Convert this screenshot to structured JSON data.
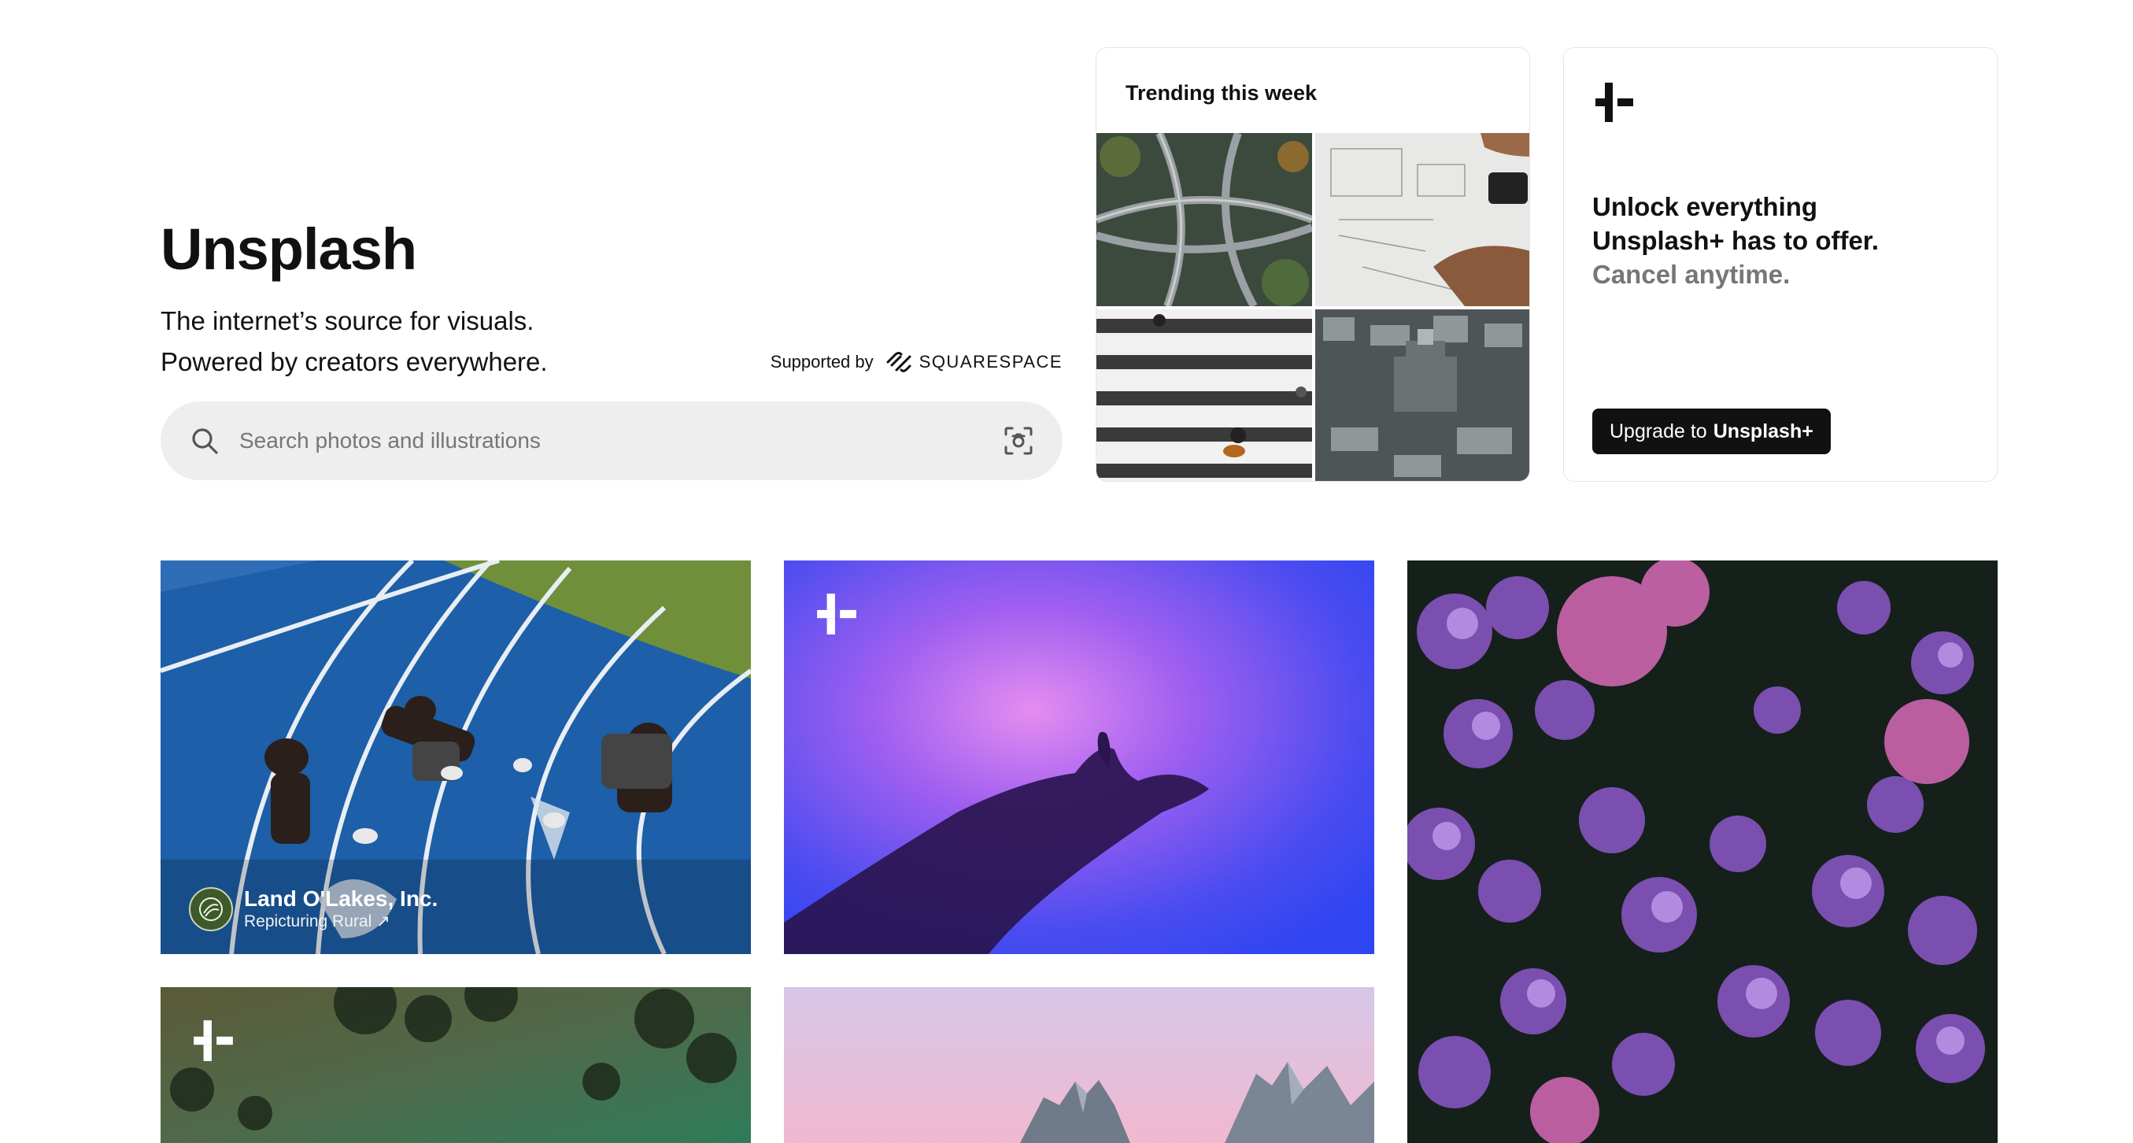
{
  "hero": {
    "title": "Unsplash",
    "tagline_line1": "The internet’s source for visuals.",
    "tagline_line2": "Powered by creators everywhere.",
    "supported_by": "Supported by",
    "sponsor_logo_text": "SQUARESPACE"
  },
  "search": {
    "placeholder": "Search photos and illustrations",
    "value": "",
    "icon": "search-icon",
    "visual_search_icon": "visual-search-icon"
  },
  "trending": {
    "title": "Trending this week",
    "images": [
      "highway-interchange-aerial",
      "architect-drawing-plans",
      "pedestrian-crosswalk-aerial",
      "miniature-temple-city"
    ]
  },
  "plus_card": {
    "icon": "unsplash-plus-icon",
    "headline_line1": "Unlock everything",
    "headline_line2": "Unsplash+ has to offer.",
    "subline": "Cancel anytime.",
    "button_prefix": "Upgrade to",
    "button_bold": "Unsplash+"
  },
  "photos": [
    {
      "subject": "athletes-resting-on-running-track",
      "sponsor_name": "Land O'Lakes, Inc.",
      "sponsor_link": "Repicturing Rural ↗"
    },
    {
      "subject": "hand-silhouette-purple-gradient",
      "badge": "unsplash-plus-icon"
    },
    {
      "subject": "purple-lilac-flowers"
    },
    {
      "subject": "forest-leaves-green-light",
      "badge": "unsplash-plus-icon"
    },
    {
      "subject": "mountain-peaks-pink-sky"
    }
  ],
  "colors": {
    "text": "#111111",
    "muted": "#767676",
    "search_bg": "#eeeeee",
    "button_bg": "#111111",
    "card_border": "#e5e5e5"
  }
}
